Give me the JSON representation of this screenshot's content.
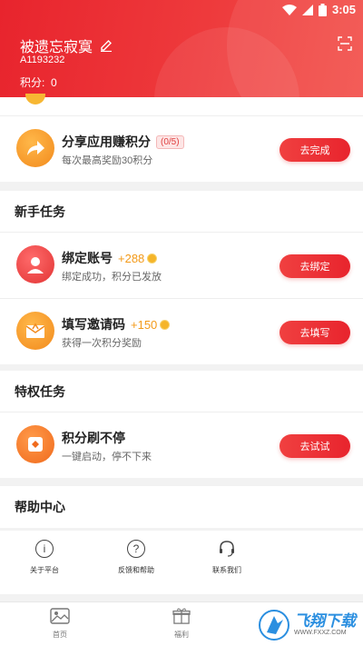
{
  "status": {
    "time": "3:05"
  },
  "profile": {
    "username": "被遗忘寂寞",
    "user_id": "A1193232",
    "points_label": "积分:",
    "points_value": "0"
  },
  "tasks_top": [
    {
      "title": "分享应用赚积分",
      "badge": "(0/5)",
      "sub": "每次最高奖励30积分",
      "button": "去完成"
    }
  ],
  "section_newbie": "新手任务",
  "tasks_newbie": [
    {
      "title": "绑定账号",
      "bonus": "+288",
      "sub": "绑定成功，积分已发放",
      "button": "去绑定"
    },
    {
      "title": "填写邀请码",
      "bonus": "+150",
      "sub": "获得一次积分奖励",
      "button": "去填写"
    }
  ],
  "section_privilege": "特权任务",
  "tasks_privilege": [
    {
      "title": "积分刷不停",
      "sub": "一键启动，停不下来",
      "button": "去试试"
    }
  ],
  "section_help": "帮助中心",
  "help_items": [
    {
      "label": "关于平台",
      "icon": "info-icon"
    },
    {
      "label": "反馈和帮助",
      "icon": "question-icon"
    },
    {
      "label": "联系我们",
      "icon": "headset-icon"
    }
  ],
  "tabs": [
    {
      "label": "首页",
      "icon": "image-icon"
    },
    {
      "label": "福利",
      "icon": "gift-icon"
    }
  ],
  "watermark": {
    "text": "飞翔下载",
    "url": "WWW.FXXZ.COM"
  },
  "colors": {
    "accent": "#e8242d",
    "bonus": "#f39a19"
  }
}
